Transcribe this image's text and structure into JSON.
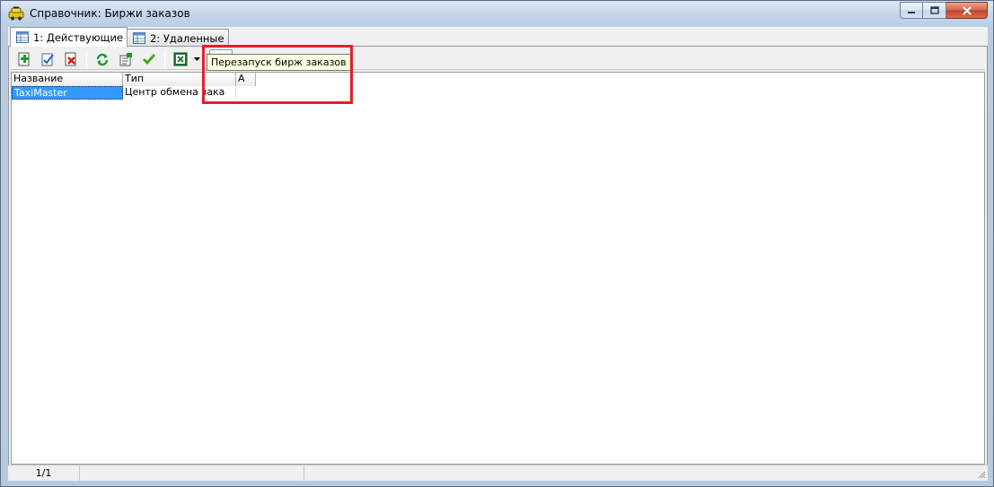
{
  "window": {
    "title": "Справочник: Биржи заказов"
  },
  "tabs": [
    {
      "label": "1: Действующие",
      "active": true
    },
    {
      "label": "2: Удаленные",
      "active": false
    }
  ],
  "toolbar": {
    "buttons": [
      {
        "name": "add-icon"
      },
      {
        "name": "edit-icon"
      },
      {
        "name": "delete-icon"
      },
      {
        "name": "refresh-icon"
      },
      {
        "name": "properties-icon"
      },
      {
        "name": "check-icon"
      },
      {
        "name": "excel-export-icon"
      },
      {
        "name": "restart-gear-icon"
      }
    ]
  },
  "grid": {
    "columns": [
      "Название",
      "Тип",
      "А"
    ],
    "rows": [
      {
        "name": "TaxiMaster",
        "type": "Центр обмена зака"
      }
    ]
  },
  "tooltip": {
    "text": "Перезапуск бирж заказов"
  },
  "status": {
    "record": "1/1"
  },
  "colors": {
    "highlight": "#e3202a",
    "selection": "#3399ff",
    "tooltip_bg": "#ffffe1"
  }
}
